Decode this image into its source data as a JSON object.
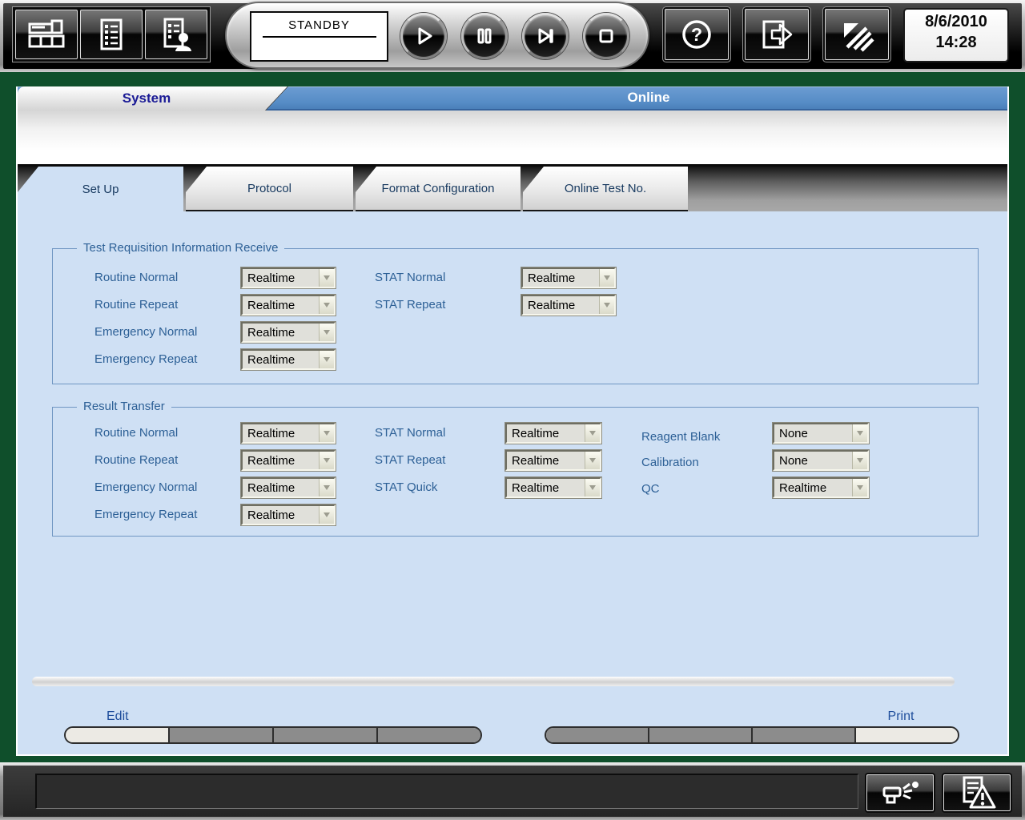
{
  "topbar": {
    "status_display": "STANDBY",
    "datetime": {
      "date": "8/6/2010",
      "time": "14:28"
    },
    "icons": {
      "left_buttons": [
        "analyzer",
        "worklist",
        "patient-list"
      ],
      "media_buttons": [
        "start",
        "pause",
        "sampler-stop",
        "stop"
      ],
      "right_buttons": [
        "help",
        "logoff",
        "diagonal-stripes"
      ],
      "bottom_buttons": [
        "barcode-scanner",
        "document-warning"
      ]
    }
  },
  "header": {
    "system_tab": "System",
    "screen_title": "Online"
  },
  "tabs": [
    {
      "label": "Set Up",
      "active": true
    },
    {
      "label": "Protocol",
      "active": false
    },
    {
      "label": "Format Configuration",
      "active": false
    },
    {
      "label": "Online Test No.",
      "active": false
    }
  ],
  "groups": [
    {
      "title": "Test Requisition Information Receive",
      "columns": [
        {
          "fields": [
            {
              "label": "Routine Normal",
              "value": "Realtime"
            },
            {
              "label": "Routine Repeat",
              "value": "Realtime"
            },
            {
              "label": "Emergency Normal",
              "value": "Realtime"
            },
            {
              "label": "Emergency Repeat",
              "value": "Realtime"
            }
          ]
        },
        {
          "fields": [
            {
              "label": "STAT Normal",
              "value": "Realtime"
            },
            {
              "label": "STAT Repeat",
              "value": "Realtime"
            }
          ]
        }
      ]
    },
    {
      "title": "Result Transfer",
      "columns": [
        {
          "fields": [
            {
              "label": "Routine Normal",
              "value": "Realtime"
            },
            {
              "label": "Routine Repeat",
              "value": "Realtime"
            },
            {
              "label": "Emergency Normal",
              "value": "Realtime"
            },
            {
              "label": "Emergency Repeat",
              "value": "Realtime"
            }
          ]
        },
        {
          "fields": [
            {
              "label": "STAT Normal",
              "value": "Realtime"
            },
            {
              "label": "STAT Repeat",
              "value": "Realtime"
            },
            {
              "label": "STAT Quick",
              "value": "Realtime"
            }
          ]
        },
        {
          "fields": [
            {
              "label": "Reagent Blank",
              "value": "None"
            },
            {
              "label": "Calibration",
              "value": "None"
            },
            {
              "label": "QC",
              "value": "Realtime"
            }
          ]
        }
      ]
    }
  ],
  "footer": {
    "edit_label": "Edit",
    "print_label": "Print"
  },
  "colors": {
    "background_green": "#0f4f2b",
    "panel_blue": "#cfe0f4",
    "title_bar_blue": "#5b92ca",
    "label_blue": "#2d6096",
    "system_navy": "#1c1c96"
  }
}
